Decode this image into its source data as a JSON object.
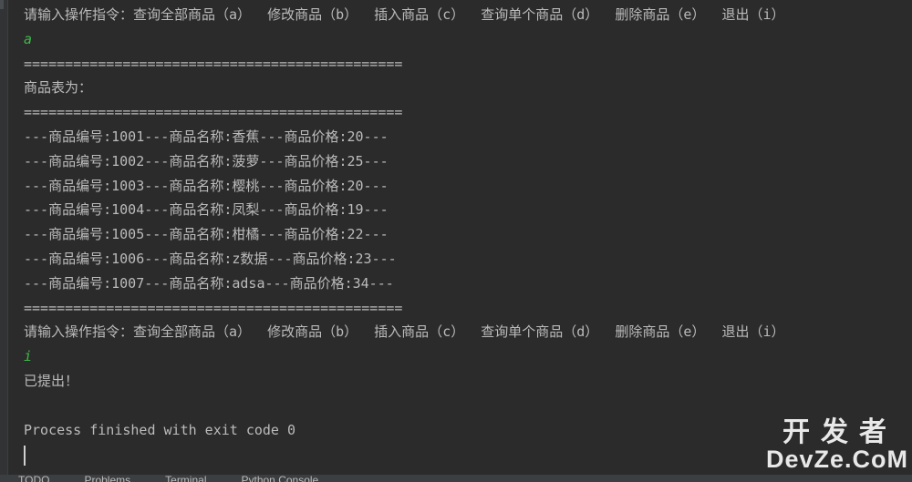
{
  "console": {
    "lines": [
      {
        "kind": "prompt",
        "text": "请输入操作指令：查询全部商品（a）  修改商品（b）  插入商品（c）  查询单个商品（d）  删除商品（e）  退出（i）"
      },
      {
        "kind": "input",
        "text": "a"
      },
      {
        "kind": "text",
        "text": "=============================================="
      },
      {
        "kind": "text",
        "text": "商品表为："
      },
      {
        "kind": "text",
        "text": "=============================================="
      },
      {
        "kind": "text",
        "text": "---商品编号:1001---商品名称:香蕉---商品价格:20---"
      },
      {
        "kind": "text",
        "text": "---商品编号:1002---商品名称:菠萝---商品价格:25---"
      },
      {
        "kind": "text",
        "text": "---商品编号:1003---商品名称:樱桃---商品价格:20---"
      },
      {
        "kind": "text",
        "text": "---商品编号:1004---商品名称:凤梨---商品价格:19---"
      },
      {
        "kind": "text",
        "text": "---商品编号:1005---商品名称:柑橘---商品价格:22---"
      },
      {
        "kind": "text",
        "text": "---商品编号:1006---商品名称:z数据---商品价格:23---"
      },
      {
        "kind": "text",
        "text": "---商品编号:1007---商品名称:adsa---商品价格:34---"
      },
      {
        "kind": "text",
        "text": "=============================================="
      },
      {
        "kind": "prompt",
        "text": "请输入操作指令：查询全部商品（a）  修改商品（b）  插入商品（c）  查询单个商品（d）  删除商品（e）  退出（i）"
      },
      {
        "kind": "input",
        "text": "i"
      },
      {
        "kind": "text",
        "text": "已提出！"
      },
      {
        "kind": "gap",
        "text": ""
      },
      {
        "kind": "process",
        "text": "Process finished with exit code 0"
      }
    ]
  },
  "statusbar": {
    "items": [
      "TODO",
      "Problems",
      "Terminal",
      "Python Console"
    ]
  },
  "watermark": {
    "top": "开发者",
    "bottom": "DevZe.CoM"
  },
  "colors": {
    "background": "#2b2b2b",
    "text": "#bbbbbb",
    "input": "#3dba46"
  }
}
